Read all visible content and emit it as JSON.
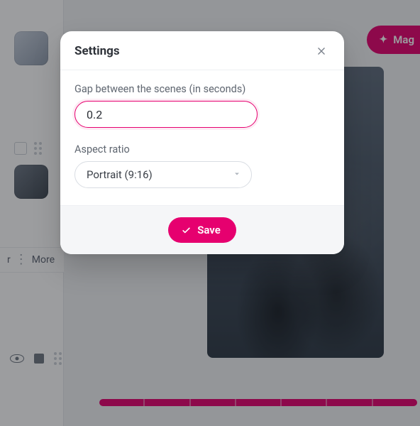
{
  "colors": {
    "accent": "#e6006f"
  },
  "header": {
    "magic_label": "Mag",
    "magic_icon": "sparkle-icon"
  },
  "sidebar": {
    "thumbs": [
      "clip-thumb-1",
      "clip-thumb-2"
    ],
    "more_label": "More",
    "bottom_icons": [
      "visibility-icon",
      "delete-icon",
      "drag-handle-icon"
    ]
  },
  "modal": {
    "title": "Settings",
    "close_icon": "close-icon",
    "gap_label": "Gap between the scenes (in seconds)",
    "gap_value": "0.2",
    "aspect_label": "Aspect ratio",
    "aspect_selected": "Portrait (9:16)",
    "save_label": "Save",
    "save_icon": "check-icon"
  },
  "timeline": {
    "segments": 7
  }
}
